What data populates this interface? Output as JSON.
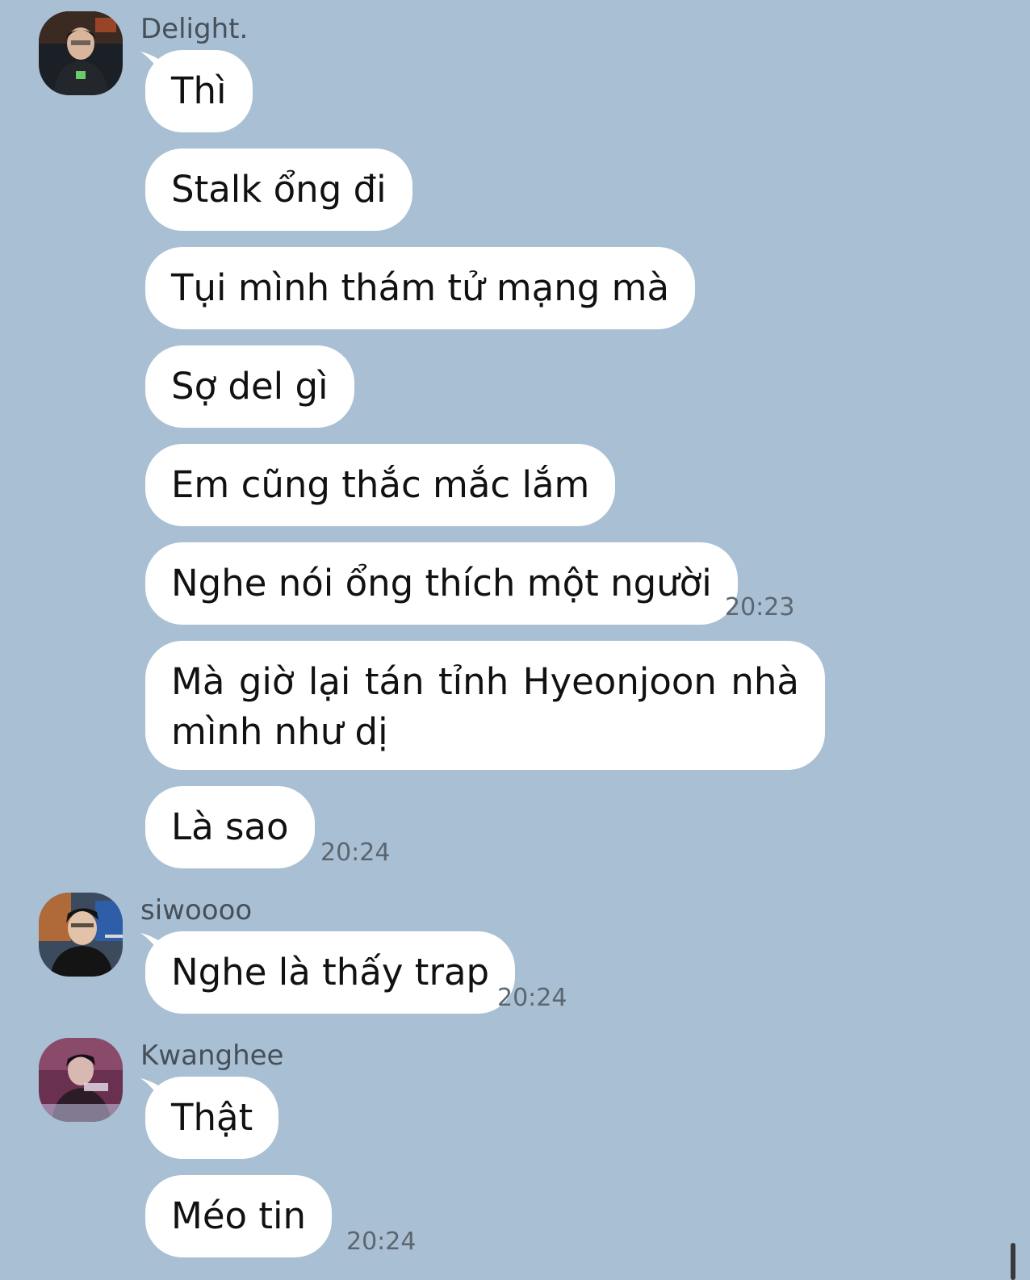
{
  "groups": [
    {
      "sender": "Delight.",
      "avatar": "delight-avatar",
      "messages": [
        "Thì",
        "Stalk ổng đi",
        "Tụi mình thám tử mạng mà",
        "Sợ del gì",
        "Em cũng thắc mắc lắm",
        "Nghe nói ổng thích một người"
      ],
      "time_1": "20:23",
      "long_message": [
        "Mà giờ lại tán tỉnh Hyeonjoon nhà",
        "mình như dị"
      ],
      "last_message": "Là sao",
      "time_2": "20:24"
    },
    {
      "sender": "siwoooo",
      "avatar": "siwoooo-avatar",
      "messages": [
        "Nghe là thấy trap"
      ],
      "time": "20:24"
    },
    {
      "sender": "Kwanghee",
      "avatar": "kwanghee-avatar",
      "messages": [
        "Thật",
        "Méo tin"
      ],
      "time": "20:24"
    }
  ],
  "colors": {
    "background": "#a9bfd3",
    "bubble": "#ffffff",
    "sender_text": "#46505a",
    "time_text": "#5c6670"
  }
}
